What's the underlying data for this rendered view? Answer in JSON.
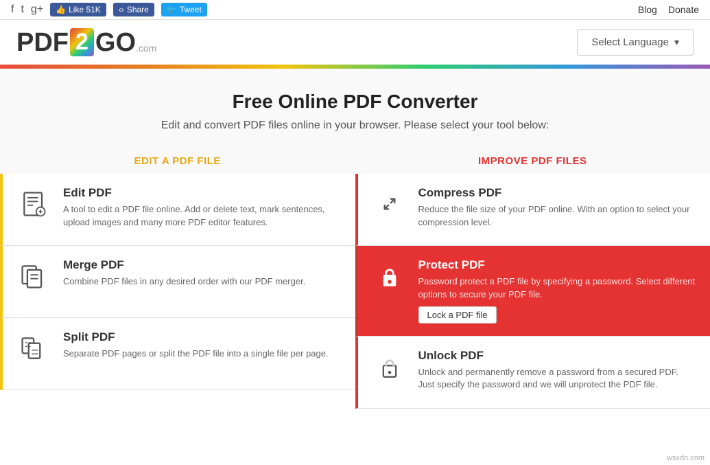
{
  "topbar": {
    "social_icons": [
      "f",
      "t",
      "g+"
    ],
    "like_label": "Like 51K",
    "share_label": "Share",
    "tweet_label": "Tweet",
    "blog_label": "Blog",
    "donate_label": "Donate"
  },
  "header": {
    "logo_left": "PDF",
    "logo_num": "2",
    "logo_right": "GO",
    "logo_com": ".com",
    "lang_btn": "Select Language"
  },
  "hero": {
    "title": "Free Online PDF Converter",
    "subtitle": "Edit and convert PDF files online in your browser. Please select your tool below:"
  },
  "left_col": {
    "header": "EDIT A PDF FILE",
    "tools": [
      {
        "title": "Edit PDF",
        "description": "A tool to edit a PDF file online. Add or delete text, mark sentences, upload images and many more PDF editor features."
      },
      {
        "title": "Merge PDF",
        "description": "Combine PDF files in any desired order with our PDF merger."
      },
      {
        "title": "Split PDF",
        "description": "Separate PDF pages or split the PDF file into a single file per page."
      }
    ]
  },
  "right_col": {
    "header": "IMPROVE PDF FILES",
    "tools": [
      {
        "title": "Compress PDF",
        "description": "Reduce the file size of your PDF online. With an option to select your compression level.",
        "highlighted": false
      },
      {
        "title": "Protect PDF",
        "description": "Password protect a PDF file by specifying a password. Select different options to secure your PDF file.",
        "highlighted": true,
        "btn_label": "Lock a PDF file"
      },
      {
        "title": "Unlock PDF",
        "description": "Unlock and permanently remove a password from a secured PDF. Just specify the password and we will unprotect the PDF file.",
        "highlighted": false
      }
    ]
  },
  "watermark": "wsxdn.com"
}
